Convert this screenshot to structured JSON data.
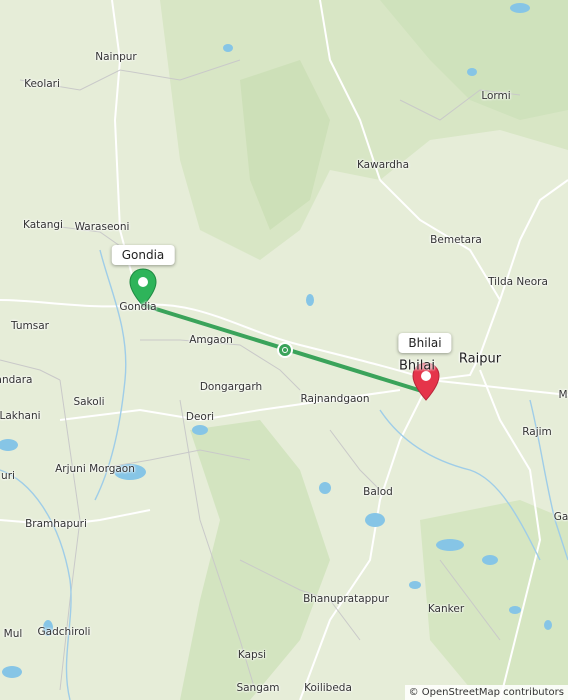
{
  "colors": {
    "route": "#3aa35a",
    "start_pin": "#2eb45a",
    "end_pin": "#e5344a",
    "water": "#86c5e6",
    "road": "#ffffff"
  },
  "places": {
    "nainpur": "Nainpur",
    "keolari": "Keolari",
    "lormi": "Lormi",
    "kawardha": "Kawardha",
    "katangi": "Katangi",
    "waraseoni": "Waraseoni",
    "bemetara": "Bemetara",
    "tilda_neora": "Tilda Neora",
    "gondia": "Gondia",
    "tumsar": "Tumsar",
    "amgaon": "Amgaon",
    "raipur": "Raipur",
    "bhilai": "Bhilai",
    "andara": "andara",
    "dongargarh": "Dongargarh",
    "rajnandgaon": "Rajnandgaon",
    "m": "M",
    "lakhani": "Lakhani",
    "sakoli": "Sakoli",
    "deori": "Deori",
    "rajim": "Rajim",
    "arjuni": "Arjuni Morgaon",
    "uri": "uri",
    "balod": "Balod",
    "bramhapuri": "Bramhapuri",
    "ga": "Ga",
    "bhanupratappur": "Bhanupratappur",
    "kanker": "Kanker",
    "mul": "Mul",
    "gadchiroli": "Gadchiroli",
    "kapsi": "Kapsi",
    "sangam": "Sangam",
    "koilibeda": "Koilibeda"
  },
  "route": {
    "start_label": "Gondia",
    "end_label": "Bhilai"
  },
  "icons": {
    "start": "start-pin-icon",
    "end": "end-pin-icon",
    "midpoint": "route-midpoint-icon"
  },
  "attribution": "© OpenStreetMap contributors"
}
